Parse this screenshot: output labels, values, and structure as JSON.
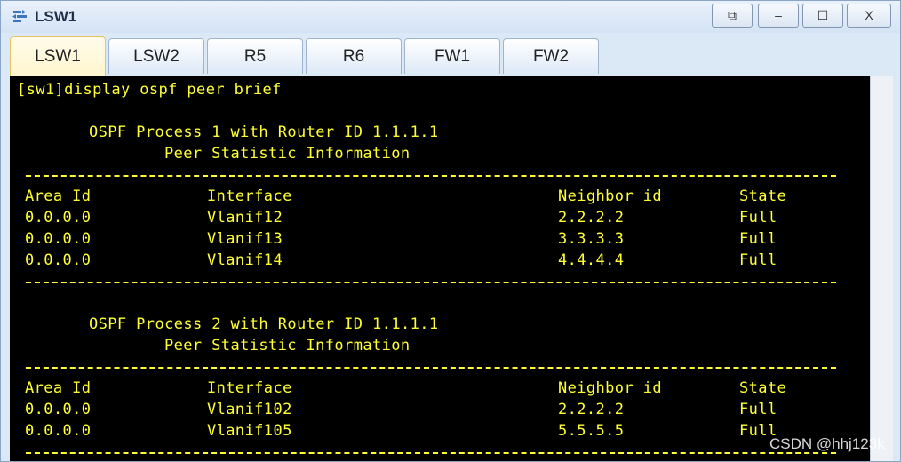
{
  "window": {
    "title": "LSW1"
  },
  "controls": {
    "restore": "⧉",
    "minimize": "–",
    "maximize": "☐",
    "close": "X"
  },
  "tabs": [
    {
      "label": "LSW1",
      "active": true
    },
    {
      "label": "LSW2",
      "active": false
    },
    {
      "label": "R5",
      "active": false
    },
    {
      "label": "R6",
      "active": false
    },
    {
      "label": "FW1",
      "active": false
    },
    {
      "label": "FW2",
      "active": false
    }
  ],
  "terminal": {
    "command": "[sw1]display ospf peer brief",
    "process1": {
      "header": "OSPF Process 1 with Router ID 1.1.1.1",
      "subheader": "Peer Statistic Information",
      "columns": [
        "Area Id",
        "Interface",
        "Neighbor id",
        "State"
      ],
      "rows": [
        [
          "0.0.0.0",
          "Vlanif12",
          "2.2.2.2",
          "Full"
        ],
        [
          "0.0.0.0",
          "Vlanif13",
          "3.3.3.3",
          "Full"
        ],
        [
          "0.0.0.0",
          "Vlanif14",
          "4.4.4.4",
          "Full"
        ]
      ]
    },
    "process2": {
      "header": "OSPF Process 2 with Router ID 1.1.1.1",
      "subheader": "Peer Statistic Information",
      "columns": [
        "Area Id",
        "Interface",
        "Neighbor id",
        "State"
      ],
      "rows": [
        [
          "0.0.0.0",
          "Vlanif102",
          "2.2.2.2",
          "Full"
        ],
        [
          "0.0.0.0",
          "Vlanif105",
          "5.5.5.5",
          "Full"
        ]
      ]
    },
    "text_color": "#ffff33",
    "background": "#000000"
  },
  "watermark": "CSDN @hhj123k"
}
